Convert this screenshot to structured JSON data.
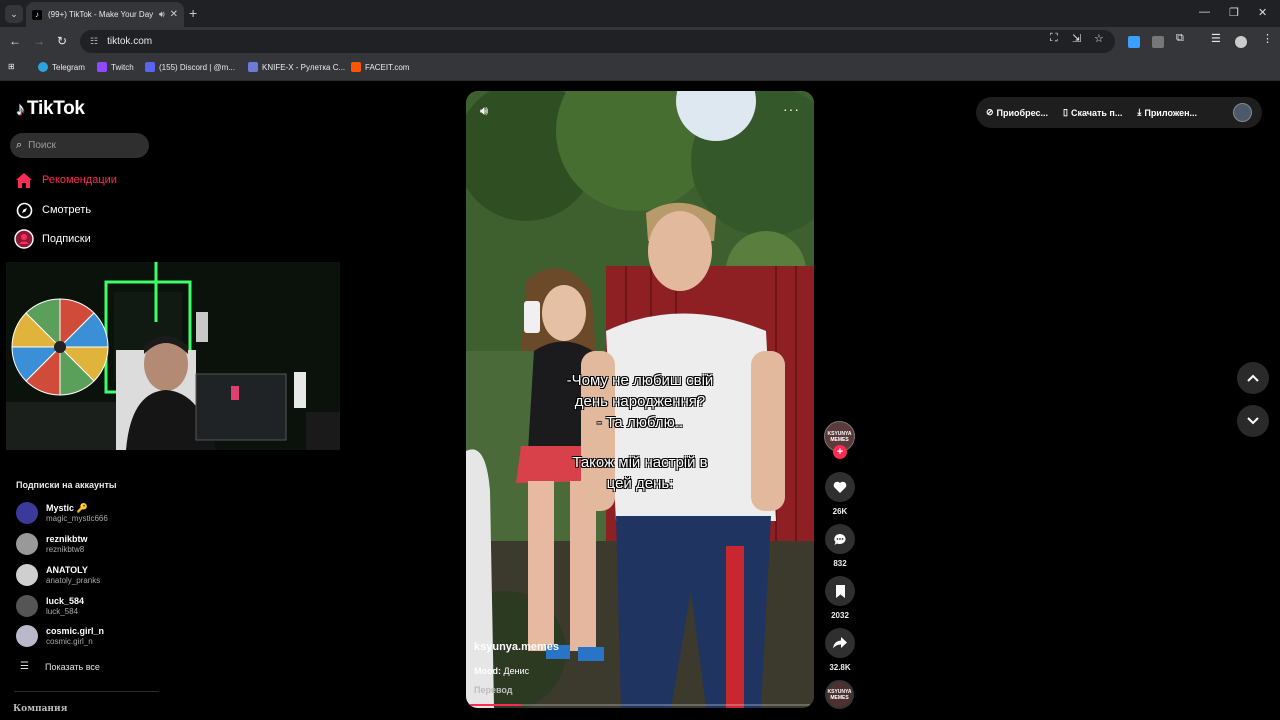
{
  "browser": {
    "tab_title": "(99+) TikTok - Make Your Day",
    "url": "tiktok.com",
    "bookmarks": [
      {
        "label": "Telegram",
        "color": "#2aa3de"
      },
      {
        "label": "Twitch",
        "color": "#9146ff"
      },
      {
        "label": "(155) Discord | @m...",
        "color": "#5865f2"
      },
      {
        "label": "KNIFE-X - Рулетка С...",
        "color": "#6b7bd6"
      },
      {
        "label": "FACEIT.com",
        "color": "#ff5500"
      }
    ]
  },
  "sidebar": {
    "logo": "TikTok",
    "search_placeholder": "Поиск",
    "nav": [
      {
        "label": "Рекомендации",
        "icon": "home-icon",
        "active": true
      },
      {
        "label": "Смотреть",
        "icon": "compass-icon",
        "active": false
      },
      {
        "label": "Подписки",
        "icon": "following-icon",
        "active": false
      }
    ],
    "subs_heading": "Подписки на аккаунты",
    "subs": [
      {
        "name": "Mystic 🔑",
        "handle": "magic_mystic666",
        "color": "#3a3a9a"
      },
      {
        "name": "reznikbtw",
        "handle": "reznikbtw8",
        "color": "#999999"
      },
      {
        "name": "ANATOLY",
        "handle": "anatoly_pranks",
        "color": "#cfcfcf"
      },
      {
        "name": "luck_584",
        "handle": "luck_584",
        "color": "#555555"
      },
      {
        "name": "cosmic.girl_n",
        "handle": "cosmic.girl_n",
        "color": "#b9b9c9"
      }
    ],
    "show_all": "Показать все",
    "company": "Компания"
  },
  "video": {
    "caption_1": [
      "-Чому не любиш свій",
      "день народження?",
      "- Та люблю.."
    ],
    "caption_2": [
      "Також мій настрій в",
      "цей день:"
    ],
    "author": "ksyunya.memes",
    "desc_label": "Mood:",
    "desc_text": "Денис",
    "translate": "Перевод",
    "progress": 0.15
  },
  "actions": {
    "avatar_text": "KSYUNYA MEMES",
    "likes": "26K",
    "comments": "832",
    "saves": "2032",
    "shares": "32.8K"
  },
  "top_right": {
    "coins": "Приобрес...",
    "download": "Скачать п...",
    "app": "Приложен..."
  }
}
